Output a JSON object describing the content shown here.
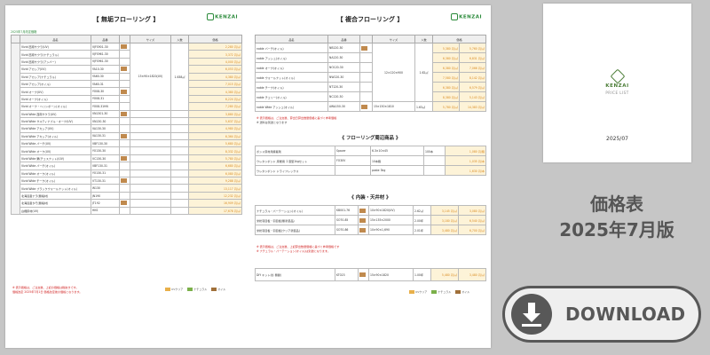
{
  "left_page": {
    "title": "【 無垢フローリング 】",
    "logo": "KENZAI",
    "subtitle": "2025年7月改定価格",
    "headers": [
      "品名",
      "品番",
      "",
      "サイズ",
      "入数",
      "価格"
    ],
    "rows": [
      {
        "name": "Vivid 西南サクラ(UV)",
        "code": "VJFS901-30",
        "price": "2,280 円/㎡"
      },
      {
        "name": "Vivid 西南サクラ(ナチュラル)",
        "code": "VJFS961-30",
        "price": "3,372 円/㎡"
      },
      {
        "name": "Vivid 西南サクラ(アンバー)",
        "code": "VJFS961-30",
        "price": "4,000 円/㎡"
      },
      {
        "name": "Vivid アカシア(UV)",
        "code": "YA10-30",
        "price": "6,053 円/㎡"
      },
      {
        "name": "Vivid アカシア(ナチュラル)",
        "code": "YA60-30",
        "price": "4,380 円/㎡"
      },
      {
        "name": "Vivid アカシア(オイル)",
        "code": "YA60-31",
        "price": "7,015 円/㎡"
      },
      {
        "name": "Vivid オーク(UV)",
        "code": "YO08-30",
        "price": "4,380 円/㎡"
      },
      {
        "name": "Vivid オーク(オイル)",
        "code": "YO08-31",
        "price": "6,224 円/㎡"
      },
      {
        "name": "Vivid オーク・ヘリンボーン(オイル)",
        "code": "YO08-31HN",
        "price": "7,280 円/㎡"
      },
      {
        "name": "Vivid Wide 西南サクラ(UV)",
        "code": "VN1301-30",
        "price": "3,880 円/㎡"
      },
      {
        "name": "Vivid Wide サスティナブル・オーク(UV)",
        "code": "VN130-30",
        "price": "5,637 円/㎡"
      },
      {
        "name": "Vivid Wide アカシア(UV)",
        "code": "VA130-30",
        "price": "4,980 円/㎡"
      },
      {
        "name": "Vivid Wide アカシア(オイル)",
        "code": "VA130-31",
        "price": "6,364 円/㎡"
      },
      {
        "name": "Vivid Wide バーチ(UV)",
        "code": "VBF130-30",
        "price": "5,680 円/㎡"
      },
      {
        "name": "Vivid Wide オーク(UV)",
        "code": "YO130-30",
        "price": "8,332 円/㎡"
      },
      {
        "name": "Vivid Wide 栗(チェスナット)(UV)",
        "code": "VC130-30",
        "price": "5,780 円/㎡"
      },
      {
        "name": "Vivid Wide バーチ(オイル)",
        "code": "VBF130-31",
        "price": "6,680 円/㎡"
      },
      {
        "name": "Vivid Wide オーク(オイル)",
        "code": "YO130-31",
        "price": "6,080 円/㎡"
      },
      {
        "name": "Vivid Wide チーク(オイル)",
        "code": "VT130-31",
        "price": "9,288 円/㎡"
      },
      {
        "name": "Vivid Wide ブラックウォールナット(オイル)",
        "code": "W130",
        "price": "13,117 円/㎡"
      },
      {
        "name": "北海道産ナラ(無垢材)",
        "code": "JN190",
        "price": "12,232 円/㎡"
      },
      {
        "name": "北海道産タモ(無垢材)",
        "code": "JT192",
        "price": "16,909 円/㎡"
      },
      {
        "name": "白樺床材(UV)",
        "code": "HKS",
        "price": "17,678 円/㎡"
      }
    ],
    "size_main": "15×90×1820(UV)",
    "qty_main": "1.638㎡",
    "notes": [
      "※ 表示価格は、ご注文後、上記の価格は税抜きです。",
      "価格改定 2025年7月1日 価格改定後の価格となります。"
    ],
    "legend": [
      "UVクリア",
      "ナチュラル",
      "オイル"
    ]
  },
  "right_page": {
    "title": "【 複合フローリング 】",
    "logo": "KENZAI",
    "headers": [
      "品名",
      "品番",
      "",
      "サイズ",
      "入数",
      "価格"
    ],
    "rows": [
      {
        "name": "noble バーチ(オイル)",
        "code": "NB120-30",
        "price": "5,380 円/㎡",
        "price2": "5,760 円/㎡"
      },
      {
        "name": "noble アッシュ(オイル)",
        "code": "NA120-30",
        "price": "6,380 円/㎡",
        "price2": "6,831 円/㎡"
      },
      {
        "name": "noble オーク(オイル)",
        "code": "NO120-30",
        "price": "6,380 円/㎡",
        "price2": "7,066 円/㎡"
      },
      {
        "name": "noble ウォールナット(オイル)",
        "code": "NW120-30",
        "price": "7,580 円/㎡",
        "price2": "8,142 円/㎡"
      },
      {
        "name": "noble チーク(オイル)",
        "code": "NT120-30",
        "price": "6,380 円/㎡",
        "price2": "6,579 円/㎡"
      },
      {
        "name": "noble チェリー(オイル)",
        "code": "NC120-30",
        "price": "8,380 円/㎡",
        "price2": "5,143 円/㎡"
      },
      {
        "name": "noble Wide アッシュ(オイル)",
        "code": "AWA150-30",
        "price": "5,780 円/㎡",
        "price2": "14,383 円/㎡"
      }
    ],
    "size_main": "12×120×900",
    "qty_main": "1.62㎡",
    "size_wide": "15×150×1810",
    "qty_wide": "1.63㎡",
    "notes1": [
      "※ 表示価格は、ご注文後、算出日算出数量価格に基づく参考価格",
      "※ 送料は別途となります"
    ],
    "sec2_title": "《 フローリング周辺商品 》",
    "sec2_rows": [
      {
        "name": "ボンド床材用接着剤",
        "code": "Spacer",
        "size": "6.3×10×45",
        "qty": "100本",
        "price": "1,080 円/箱"
      },
      {
        "name": "ウレタンボンド 床暖用 ２液型1kgセット",
        "code": "FO30V",
        "size": "10本箱",
        "qty": "",
        "price": "1,035 円/本"
      },
      {
        "name": "ウレタンボンド ドライフレックス",
        "code": "",
        "size": "paste 3kg",
        "qty": "",
        "price": "1,630 円/本"
      }
    ],
    "sec3_title": "《 内装・天井材 》",
    "sec3_rows": [
      {
        "name": "ナチュラル・パーテーション(オイル)",
        "code": "KB001-76",
        "size": "10×90×1820(UV)",
        "qty": "2.62㎡",
        "price": "3,145 円/㎡",
        "price2": "3,080 円/㎡"
      },
      {
        "name": "米松羽目板・羽目板(無塗装品)",
        "code": "SO70-85",
        "size": "15×135×2000",
        "qty": "2.00坪",
        "price": "3,180 円/㎡",
        "price2": "6,540 円/㎡"
      },
      {
        "name": "米松羽目板・羽目板(クリア塗装品)",
        "code": "SO70-86",
        "size": "10×90×1,690",
        "qty": "2.01坪",
        "price": "3,480 円/㎡",
        "price2": "6,700 円/㎡"
      }
    ],
    "notes2": [
      "※ 表示価格は、ご注文後、上記算出数量価格に基づく参考価格です",
      "※ ナチュラル・パーテーション(オイル)は別途となります。"
    ],
    "bottom_row": {
      "name": "DIY キット(杉 無節)",
      "code": "KT023",
      "size": "15×90×1820",
      "qty": "1.00坪",
      "price": "5,480 円/㎡",
      "price2": "3,480 円/㎡"
    },
    "legend": [
      "UVクリア",
      "ナチュラル",
      "オイル"
    ]
  },
  "cover": {
    "logo": "KENZAI",
    "label": "PRICE LIST",
    "date": "2025/07"
  },
  "caption": {
    "line1": "価格表",
    "line2": "2025年7月版"
  },
  "download": {
    "label": "DOWNLOAD"
  },
  "colors": {
    "accent_green": "#2a8a3a",
    "price_bg": "#fdf3d8",
    "price_text": "#d98a1e",
    "button": "#585858",
    "background": "#c6c6c6"
  }
}
